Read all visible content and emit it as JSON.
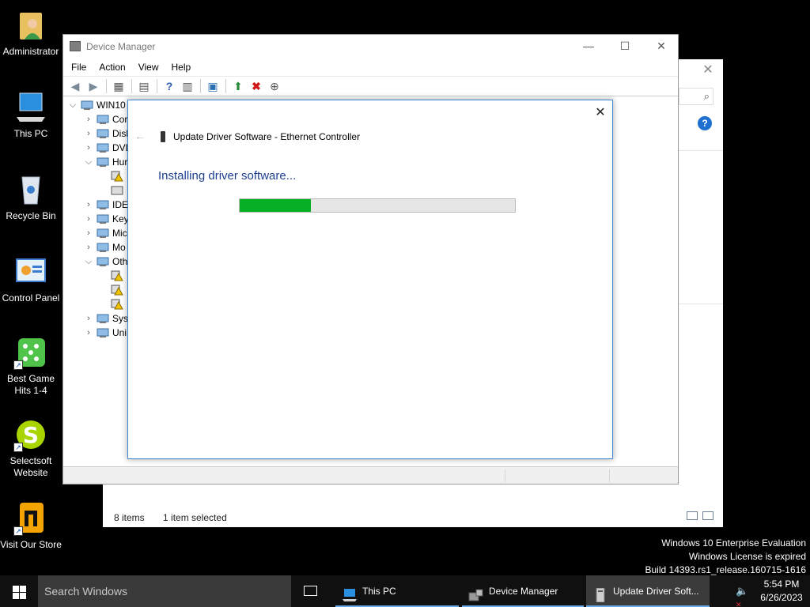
{
  "desktop": {
    "icons": [
      {
        "label": "Administrator",
        "icon": "user-folder-icon"
      },
      {
        "label": "This PC",
        "icon": "computer-icon"
      },
      {
        "label": "Recycle Bin",
        "icon": "recycle-bin-icon"
      },
      {
        "label": "Control Panel",
        "icon": "control-panel-icon"
      },
      {
        "label": "Best Game Hits 1-4",
        "icon": "dice-game-icon"
      },
      {
        "label": "Selectsoft Website",
        "icon": "selectsoft-logo-icon"
      },
      {
        "label": "Visit Our Store",
        "icon": "store-logo-icon"
      }
    ]
  },
  "explorer_bg": {
    "status_items": "8 items",
    "status_selected": "1 item selected"
  },
  "device_manager": {
    "title": "Device Manager",
    "menu": [
      "File",
      "Action",
      "View",
      "Help"
    ],
    "tree": [
      {
        "label": "WIN10",
        "level": 0,
        "expanded": true
      },
      {
        "label": "Cor",
        "level": 1,
        "expanded": false
      },
      {
        "label": "Disl",
        "level": 1,
        "expanded": false
      },
      {
        "label": "DVD",
        "level": 1,
        "expanded": false
      },
      {
        "label": "Hur",
        "level": 1,
        "expanded": true
      },
      {
        "label": "",
        "level": 2,
        "warning": true
      },
      {
        "label": "",
        "level": 2,
        "warning": false
      },
      {
        "label": "IDE",
        "level": 1,
        "expanded": false
      },
      {
        "label": "Key",
        "level": 1,
        "expanded": false
      },
      {
        "label": "Mic",
        "level": 1,
        "expanded": false
      },
      {
        "label": "Mo",
        "level": 1,
        "expanded": false
      },
      {
        "label": "Oth",
        "level": 1,
        "expanded": true
      },
      {
        "label": "",
        "level": 2,
        "warning": true
      },
      {
        "label": "",
        "level": 2,
        "warning": true
      },
      {
        "label": "",
        "level": 2,
        "warning": true
      },
      {
        "label": "Syst",
        "level": 1,
        "expanded": false
      },
      {
        "label": "Uni",
        "level": 1,
        "expanded": false
      }
    ]
  },
  "dialog": {
    "title": "Update Driver Software - Ethernet Controller",
    "heading": "Installing driver software...",
    "progress": 0.26,
    "colors": {
      "progress_fill": "#06b025",
      "heading": "#1e3f8f",
      "border": "#3f85d6"
    }
  },
  "watermark": {
    "line1": "Windows 10 Enterprise Evaluation",
    "line2": "Windows License is expired",
    "line3": "Build 14393.rs1_release.160715-1616"
  },
  "taskbar": {
    "search_placeholder": "Search Windows",
    "apps": [
      {
        "label": "This PC",
        "icon": "computer-icon",
        "active": false
      },
      {
        "label": "Device Manager",
        "icon": "device-manager-icon",
        "active": false
      },
      {
        "label": "Update Driver Soft...",
        "icon": "driver-icon",
        "active": true
      }
    ],
    "time": "5:54 PM",
    "date": "6/26/2023"
  }
}
